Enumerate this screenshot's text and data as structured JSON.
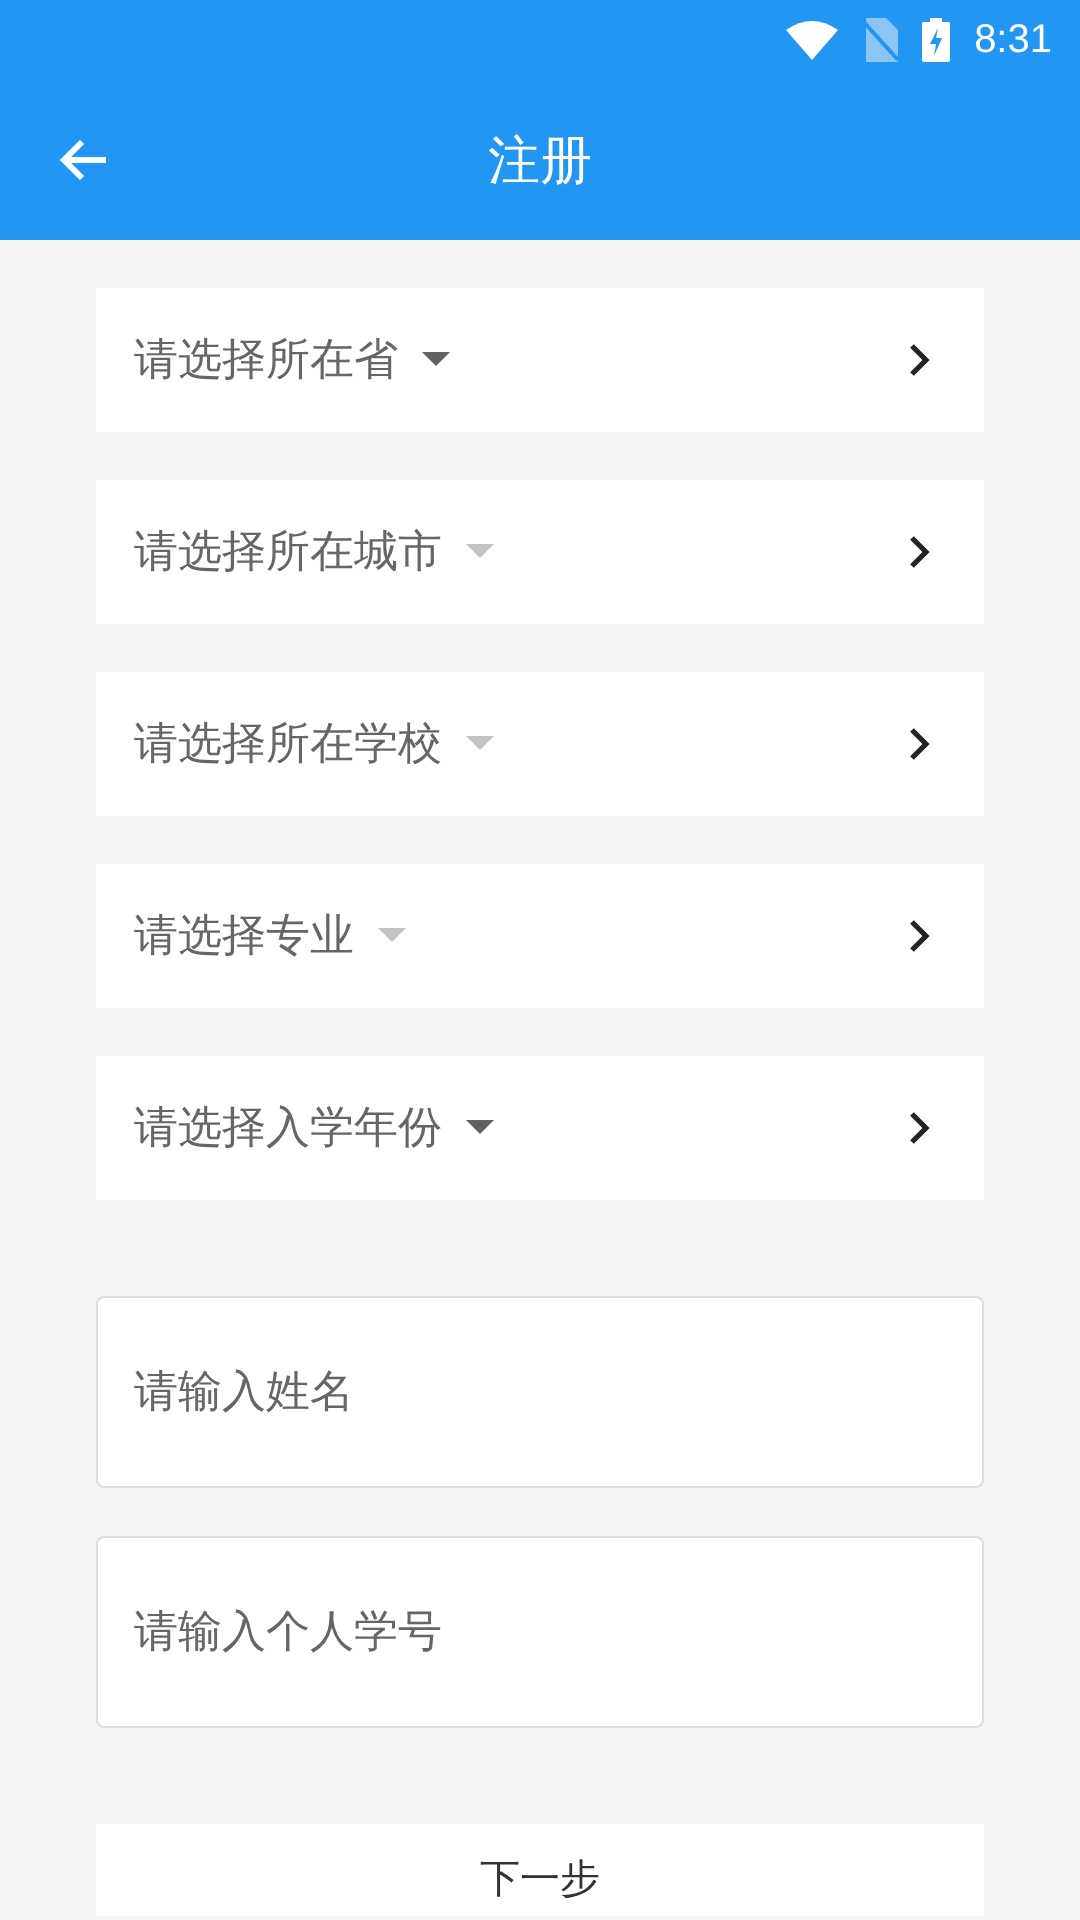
{
  "status_bar": {
    "time": "8:31"
  },
  "header": {
    "title": "注册"
  },
  "selectors": [
    {
      "label": "请选择所在省",
      "disabled": false
    },
    {
      "label": "请选择所在城市",
      "disabled": true
    },
    {
      "label": "请选择所在学校",
      "disabled": true
    },
    {
      "label": "请选择专业",
      "disabled": true
    },
    {
      "label": "请选择入学年份",
      "disabled": false
    }
  ],
  "fields": [
    {
      "placeholder": "请输入姓名"
    },
    {
      "placeholder": "请输入个人学号"
    }
  ],
  "next_button": {
    "label": "下一步"
  }
}
